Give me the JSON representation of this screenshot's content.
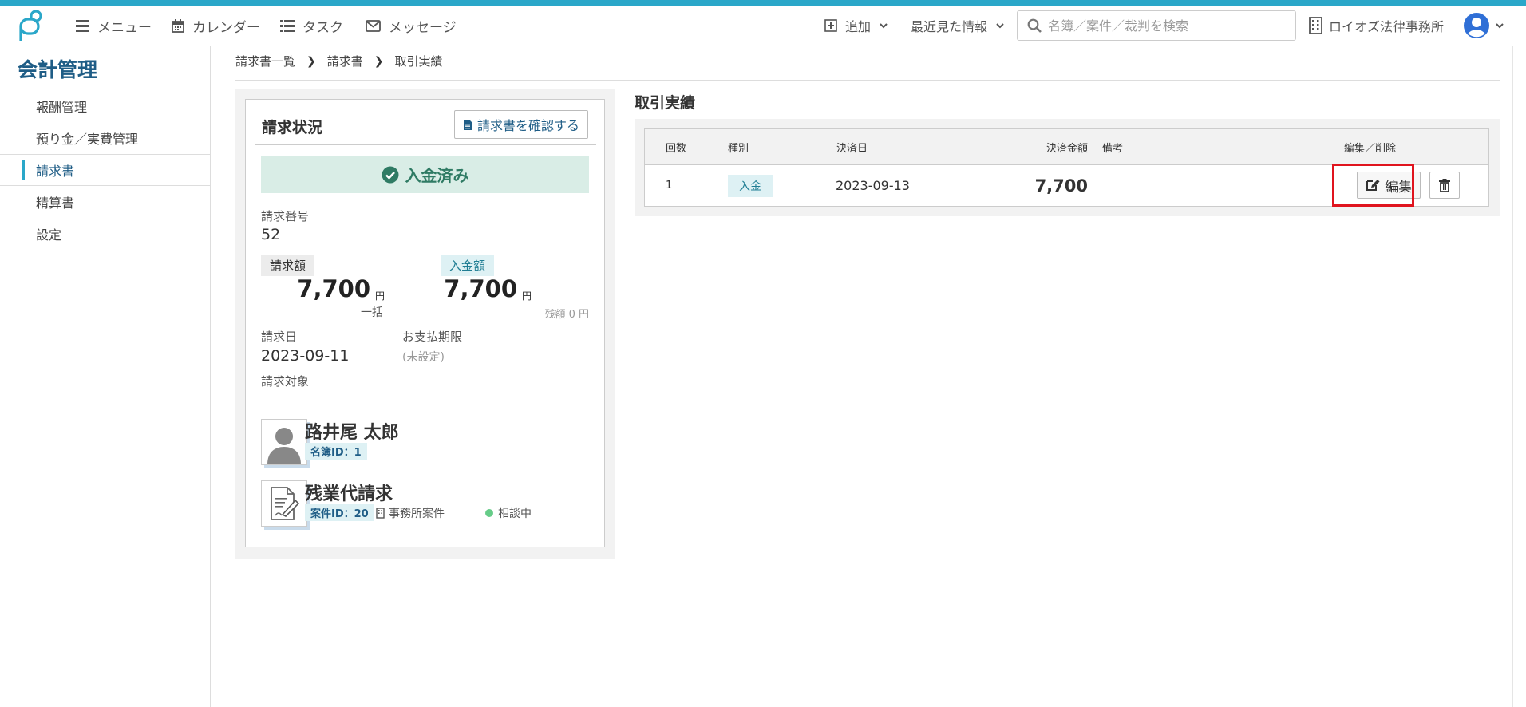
{
  "topbar": {
    "menu": "メニュー",
    "calendar": "カレンダー",
    "task": "タスク",
    "message": "メッセージ",
    "add": "追加",
    "recent": "最近見た情報",
    "search_placeholder": "名簿／案件／裁判を検索",
    "firm": "ロイオズ法律事務所"
  },
  "sidebar": {
    "title": "会計管理",
    "items": [
      {
        "label": "報酬管理"
      },
      {
        "label": "預り金／実費管理"
      },
      {
        "label": "請求書"
      },
      {
        "label": "精算書"
      },
      {
        "label": "設定"
      }
    ]
  },
  "breadcrumb": [
    "請求書一覧",
    "請求書",
    "取引実績"
  ],
  "invoice": {
    "title": "請求状況",
    "confirm_label": "請求書を確認する",
    "status": "入金済み",
    "number_label": "請求番号",
    "number": "52",
    "billed_label": "請求額",
    "billed_amount": "7,700",
    "billed_unit": "円",
    "billed_note": "一括",
    "paid_label": "入金額",
    "paid_amount": "7,700",
    "paid_unit": "円",
    "remaining": "残額 0 円",
    "date_label": "請求日",
    "date": "2023-09-11",
    "due_label": "お支払期限",
    "due": "(未設定)",
    "target_label": "請求対象",
    "person_name": "路井尾 太郎",
    "person_id": "名簿ID：1",
    "case_name": "残業代請求",
    "case_id": "案件ID：20",
    "case_type": "事務所案件",
    "case_status": "相談中"
  },
  "transactions": {
    "title": "取引実績",
    "headers": {
      "count": "回数",
      "type": "種別",
      "date": "決済日",
      "amount": "決済金額",
      "note": "備考",
      "actions": "編集／削除"
    },
    "rows": [
      {
        "count": "1",
        "type": "入金",
        "date": "2023-09-13",
        "amount": "7,700",
        "note": "",
        "edit_label": "編集"
      }
    ]
  },
  "colors": {
    "accent": "#2aa7c9",
    "navy": "#1f5d86",
    "paid_bg": "#d9ede6",
    "paid_text": "#2f7b64",
    "highlight": "#e0141e"
  }
}
